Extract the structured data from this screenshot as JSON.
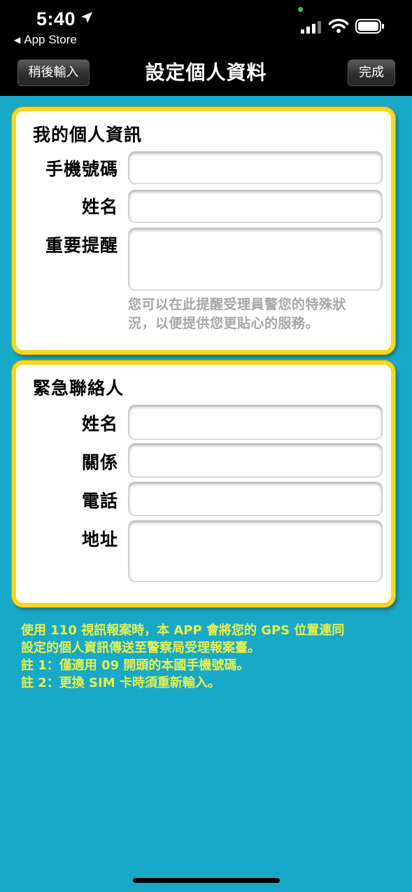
{
  "status_bar": {
    "time": "5:40",
    "back_label": "App Store"
  },
  "navbar": {
    "left_button": "稍後輸入",
    "title": "設定個人資料",
    "right_button": "完成"
  },
  "personal_info": {
    "title": "我的個人資訊",
    "phone_label": "手機號碼",
    "phone_value": "",
    "name_label": "姓名",
    "name_value": "",
    "reminder_label": "重要提醒",
    "reminder_value": "",
    "hint_line1": "您可以在此提醒受理員警您的特殊狀",
    "hint_line2": "況，以便提供您更貼心的服務。"
  },
  "emergency_contact": {
    "title": "緊急聯絡人",
    "name_label": "姓名",
    "name_value": "",
    "relation_label": "關係",
    "relation_value": "",
    "phone_label": "電話",
    "phone_value": "",
    "address_label": "地址",
    "address_value": ""
  },
  "notes": {
    "line1": "使用 110 視訊報案時，本 APP 會將您的 GPS 位置連同",
    "line2": "設定的個人資訊傳送至警察局受理報案臺。",
    "line3": "註 1：僅適用 09 開頭的本國手機號碼。",
    "line4": "註 2：更換 SIM 卡時須重新輸入。"
  },
  "colors": {
    "background": "#19a9c8",
    "card_border": "#f5d81f",
    "note_text": "#e9f04a"
  }
}
